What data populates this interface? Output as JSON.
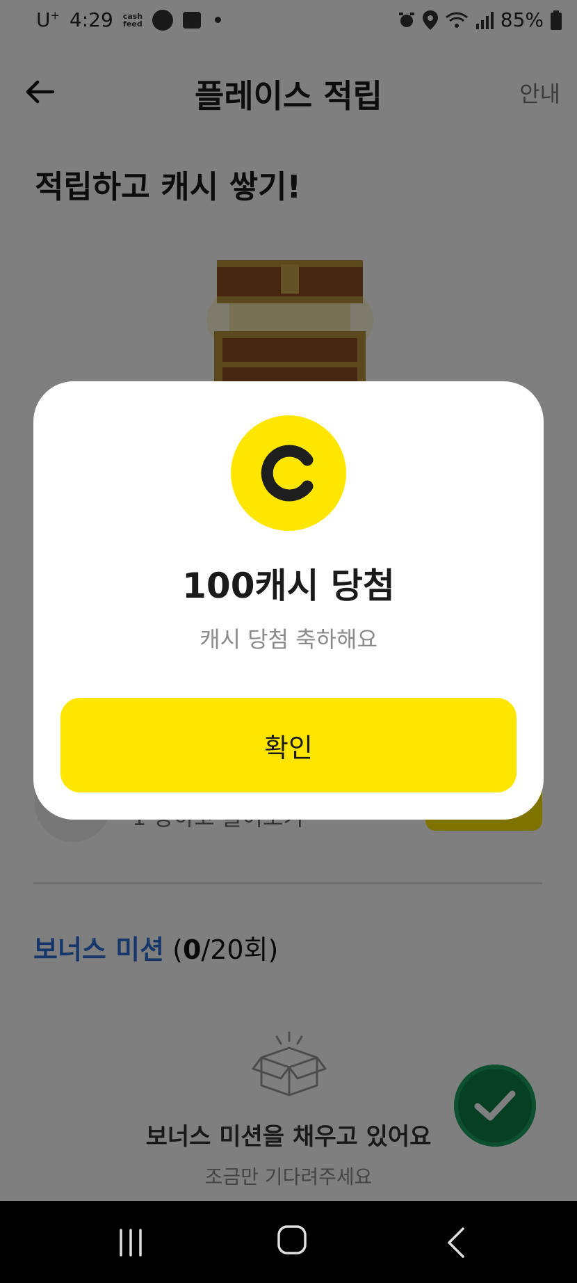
{
  "status_bar": {
    "carrier": "U",
    "carrier_sup": "+",
    "time": "4:29",
    "cash_app_line1": "cash",
    "cash_app_line2": "feed",
    "battery": "85%"
  },
  "header": {
    "title": "플레이스 적립",
    "info_label": "안내"
  },
  "main": {
    "heading": "적립하고 캐시 쌓기!",
    "obscured_row_text": "1 장하고 들어오기"
  },
  "bonus": {
    "title": "보너스 미션",
    "open_paren": " (",
    "count_current": "0",
    "count_rest": "/20회)",
    "empty_title": "보너스 미션을 채우고 있어요",
    "empty_subtitle": "조금만 기다려주세요"
  },
  "modal": {
    "title": "100캐시 당첨",
    "subtitle": "캐시 당첨 축하해요",
    "confirm_label": "확인"
  },
  "colors": {
    "accent_yellow": "#ffe600",
    "bonus_blue": "#2f6fd6",
    "fab_green": "#0f7e4a"
  },
  "icons": {
    "back": "arrow-left-icon",
    "coin": "cash-coin-icon",
    "chest": "treasure-chest-icon",
    "empty_box": "empty-box-icon",
    "fab": "check-icon"
  }
}
